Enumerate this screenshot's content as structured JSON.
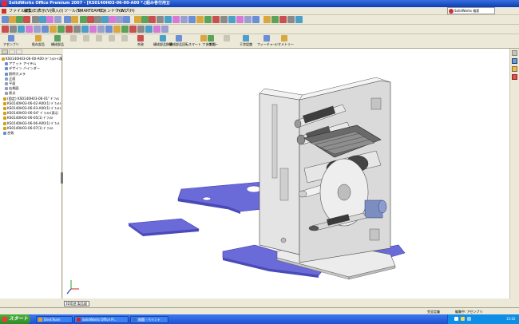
{
  "window": {
    "title": "SolidWorks Office Premium 2007 - [KS0140H03-06-00-A00 *.[組み巻付用]]"
  },
  "menu": {
    "items": [
      "ファイル(F)",
      "編集(E)",
      "表示(V)",
      "挿入(I)",
      "ツール(T)",
      "SMARTEAM(Q)",
      "ウィンドウ(W)",
      "ヘルプ(H)"
    ]
  },
  "search_box": {
    "label": "SolidWorks 検索"
  },
  "command_manager": {
    "items": [
      {
        "label": "アセンブリ",
        "icon": "assembly-icon"
      },
      {
        "label": "既存部品",
        "icon": "insert-component-icon"
      },
      {
        "label": "構成部品",
        "icon": "new-part-icon"
      },
      {
        "label": "",
        "icon": "disabled-icon"
      },
      {
        "label": "",
        "icon": "disabled-icon"
      },
      {
        "label": "",
        "icon": "disabled-icon"
      },
      {
        "label": "",
        "icon": "disabled-icon"
      },
      {
        "label": "",
        "icon": "disabled-icon"
      },
      {
        "label": "合致",
        "icon": "mate-icon"
      },
      {
        "label": "構成部品移動",
        "icon": "move-component-icon"
      },
      {
        "label": "構成部品回転",
        "icon": "rotate-component-icon"
      },
      {
        "label": "スマート ファスナー",
        "icon": "smart-fastener-icon"
      },
      {
        "label": "分解図",
        "icon": "exploded-view-icon"
      },
      {
        "label": "",
        "icon": "disabled-icon"
      },
      {
        "label": "干渉認識",
        "icon": "interference-icon"
      },
      {
        "label": "フィーチャー",
        "icon": "feature-icon"
      },
      {
        "label": "ジオメトリー",
        "icon": "geometry-icon"
      }
    ]
  },
  "feature_tree": {
    "tabs": [
      "",
      "",
      ""
    ],
    "rows": [
      {
        "label": "KS0140H03-06-00-A00 (ﾃﾞﾌｫﾙﾄ<表示",
        "icon_color": "#d4a017"
      },
      {
        "label": "アナット アイテム",
        "icon_color": "#6a8fd0"
      },
      {
        "label": "デザイン バインダー",
        "icon_color": "#6a8fd0"
      },
      {
        "label": "照明カメラ",
        "icon_color": "#6a8fd0"
      },
      {
        "label": "正面",
        "icon_color": "#8fa0c0"
      },
      {
        "label": "平面",
        "icon_color": "#8fa0c0"
      },
      {
        "label": "右側面",
        "icon_color": "#8fa0c0"
      },
      {
        "label": "原点",
        "icon_color": "#a0a0a0"
      },
      {
        "label": "(固定) KS0140H03-06-01\" ﾃﾞﾌｫﾙ",
        "icon_color": "#d4a017"
      },
      {
        "label": "KS0140H03-06-02-A00(1) ﾃﾞﾌｫﾙﾄ",
        "icon_color": "#d4a017"
      },
      {
        "label": "KS0140H03-06-03-A00(1) ﾃﾞﾌｫﾙﾄ",
        "icon_color": "#d4a017"
      },
      {
        "label": "KS0140H03-06-04\" ﾃﾞﾌｫﾙﾄ(表示",
        "icon_color": "#d4a017"
      },
      {
        "label": "KS0140H03-06-05(1) ﾃﾞﾌｫﾙﾄ",
        "icon_color": "#d4a017"
      },
      {
        "label": "KS0140H03-06-06-A00(1) ﾃﾞﾌｫﾙ",
        "icon_color": "#d4a017"
      },
      {
        "label": "KS0140H03-06-07(1) ﾃﾞﾌｫﾙﾄ",
        "icon_color": "#d4a017"
      },
      {
        "label": "合致",
        "icon_color": "#6a8fd0"
      }
    ]
  },
  "viewport": {
    "model_tab": "3D用途 製品図",
    "triad": {
      "x": "X",
      "y": "Y",
      "z": "Z"
    },
    "colors": {
      "plate": "#6a6ad8",
      "plate_edge": "#3a3aa8",
      "frame": "#e4e4e4",
      "frame_edge": "#555555"
    }
  },
  "status_bar": {
    "left": "",
    "mid1": "完全定義",
    "mid2": "編集中: アセンブリ",
    "right": ""
  },
  "taskbar": {
    "start": "スタート",
    "tasks": [
      {
        "label": "DeskTeam",
        "color": "#e0a020"
      },
      {
        "label": "SolidWorks Office Pr...",
        "color": "#d02020"
      },
      {
        "label": "無題 - ペイント",
        "color": "#3070d0"
      }
    ],
    "clock": "15:02"
  }
}
